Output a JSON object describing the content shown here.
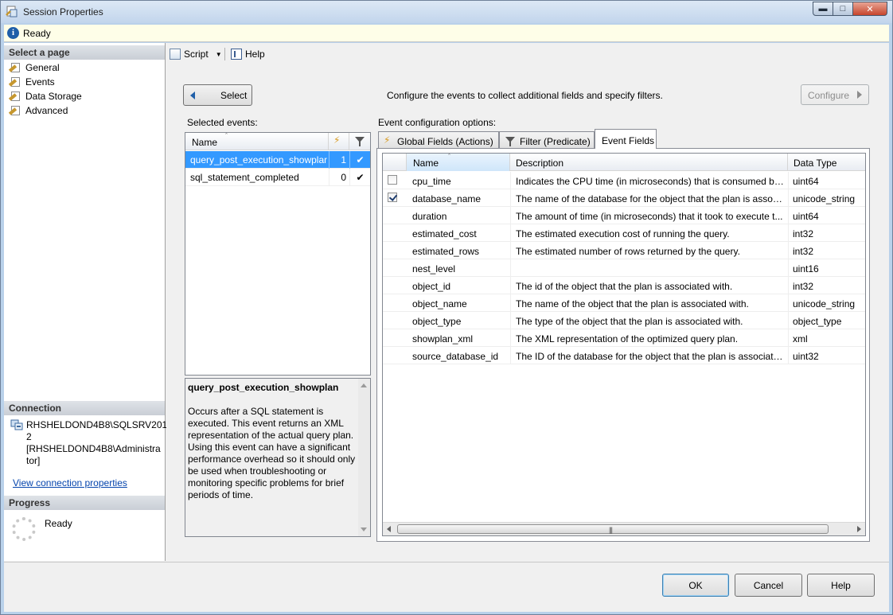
{
  "window": {
    "title": "Session Properties",
    "status": "Ready"
  },
  "left_pane": {
    "select_page_header": "Select a page",
    "pages": [
      {
        "label": "General"
      },
      {
        "label": "Events"
      },
      {
        "label": "Data Storage"
      },
      {
        "label": "Advanced"
      }
    ],
    "connection_header": "Connection",
    "connection_server_lines": [
      "RHSHELDOND4B8\\SQLSRV201",
      "2",
      "[RHSHELDOND4B8\\Administra",
      "tor]"
    ],
    "connection_link": "View connection properties",
    "progress_header": "Progress",
    "progress_status": "Ready"
  },
  "toolbar": {
    "script_label": "Script",
    "help_label": "Help"
  },
  "main": {
    "select_button": "Select",
    "instructions": "Configure the events to collect additional fields and specify filters.",
    "configure_button": "Configure",
    "selected_events_label": "Selected events:",
    "event_config_label": "Event configuration options:",
    "events_grid": {
      "name_header": "Name",
      "rows": [
        {
          "name": "query_post_execution_showplan",
          "actions": "1",
          "filter": "✔",
          "selected": true
        },
        {
          "name": "sql_statement_completed",
          "actions": "0",
          "filter": "✔",
          "selected": false
        }
      ]
    },
    "event_description": {
      "title": "query_post_execution_showplan",
      "body_lines": [
        "Occurs after a SQL statement is",
        "executed. This event returns an XML",
        "representation of the actual query plan.",
        "Using this event can have a significant",
        "performance overhead so it should only",
        "be used when troubleshooting or",
        "monitoring specific problems for brief",
        "periods of time."
      ]
    },
    "tabs": [
      {
        "label": "Global Fields (Actions)"
      },
      {
        "label": "Filter (Predicate)"
      },
      {
        "label": "Event Fields",
        "active": true
      }
    ],
    "fields_grid": {
      "headers": {
        "name": "Name",
        "description": "Description",
        "data_type": "Data Type"
      },
      "rows": [
        {
          "checked": false,
          "name": "cpu_time",
          "description": "Indicates the CPU time (in microseconds) that is consumed by ...",
          "type": "uint64"
        },
        {
          "checked": true,
          "name": "database_name",
          "description": "The name of the database for the object that the plan is associa...",
          "type": "unicode_string"
        },
        {
          "checked": false,
          "name": "duration",
          "description": "The amount of time (in microseconds) that it took to execute t...",
          "type": "uint64"
        },
        {
          "checked": false,
          "name": "estimated_cost",
          "description": "The estimated execution cost of running the query.",
          "type": "int32"
        },
        {
          "checked": false,
          "name": "estimated_rows",
          "description": "The estimated number of rows returned by the query.",
          "type": "int32"
        },
        {
          "checked": false,
          "name": "nest_level",
          "description": "",
          "type": "uint16"
        },
        {
          "checked": false,
          "name": "object_id",
          "description": "The id of the object that the plan is associated with.",
          "type": "int32"
        },
        {
          "checked": false,
          "name": "object_name",
          "description": "The name of the object that the plan is associated with.",
          "type": "unicode_string"
        },
        {
          "checked": false,
          "name": "object_type",
          "description": "The type of the object that the plan is associated with.",
          "type": "object_type"
        },
        {
          "checked": false,
          "name": "showplan_xml",
          "description": "The XML representation of the optimized query plan.",
          "type": "xml"
        },
        {
          "checked": false,
          "name": "source_database_id",
          "description": "The ID of the database for the object that the plan is associated...",
          "type": "uint32"
        }
      ]
    }
  },
  "footer": {
    "ok": "OK",
    "cancel": "Cancel",
    "help": "Help"
  }
}
